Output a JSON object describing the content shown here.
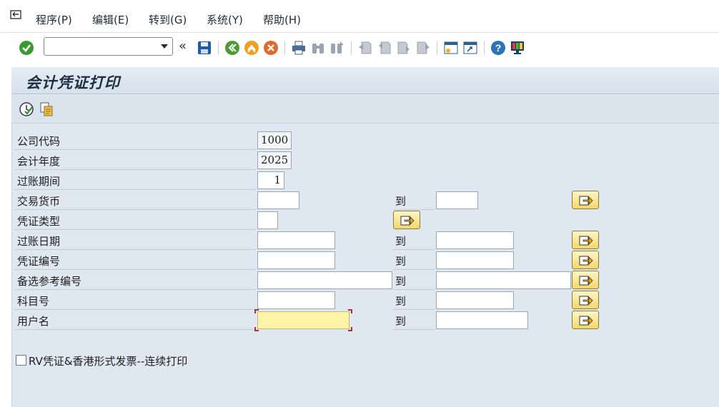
{
  "menu": {
    "items": [
      "程序(P)",
      "编辑(E)",
      "转到(G)",
      "系统(Y)",
      "帮助(H)"
    ]
  },
  "toolbar": {
    "command_field": {
      "value": ""
    },
    "icons": [
      "ok-icon",
      "save-icon",
      "back-icon",
      "exit-icon",
      "cancel-icon",
      "print-icon",
      "find-icon",
      "find-next-icon",
      "first-page-icon",
      "previous-page-icon",
      "next-page-icon",
      "last-page-icon",
      "create-session-icon",
      "shortcut-icon",
      "help-icon",
      "customize-layout-icon"
    ]
  },
  "page": {
    "title": "会计凭证打印"
  },
  "app_toolbar": {
    "icons": [
      "execute-icon",
      "get-variant-icon"
    ]
  },
  "form": {
    "rows": [
      {
        "label": "公司代码",
        "from": "1000",
        "to_label": "",
        "to": ""
      },
      {
        "label": "会计年度",
        "from": "2025",
        "to_label": "",
        "to": ""
      },
      {
        "label": "过账期间",
        "from": "1",
        "to_label": "",
        "to": ""
      },
      {
        "label": "交易货币",
        "from": "",
        "to_label": "到",
        "to": ""
      },
      {
        "label": "凭证类型",
        "from": "",
        "to_label": "",
        "to": ""
      },
      {
        "label": "过账日期",
        "from": "",
        "to_label": "到",
        "to": ""
      },
      {
        "label": "凭证编号",
        "from": "",
        "to_label": "到",
        "to": ""
      },
      {
        "label": "备选参考编号",
        "from": "",
        "to_label": "到",
        "to": ""
      },
      {
        "label": "科目号",
        "from": "",
        "to_label": "到",
        "to": ""
      },
      {
        "label": "用户名",
        "from": "",
        "to_label": "到",
        "to": ""
      }
    ],
    "checkbox": {
      "label": "RV凭证&香港形式发票--连续打印",
      "checked": false
    }
  },
  "colors": {
    "panel_bg": "#dfe8f1",
    "focused_field": "#fff3a8",
    "multi_button": "#f3d86a"
  }
}
